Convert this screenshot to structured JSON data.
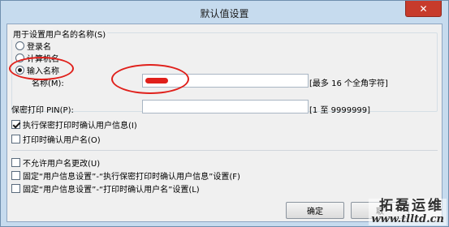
{
  "window": {
    "title": "默认值设置",
    "close_glyph": "✕"
  },
  "username_group": {
    "legend": "用于设置用户名的名称(S)",
    "options": [
      {
        "label": "登录名",
        "checked": false
      },
      {
        "label": "计算机名",
        "checked": false
      },
      {
        "label": "输入名称",
        "checked": true
      }
    ],
    "name_label": "名称(M):",
    "name_value": "",
    "name_hint": "[最多 16 个全角字符]"
  },
  "pin": {
    "label": "保密打印 PIN(P):",
    "value": "",
    "hint": "[1 至 9999999]"
  },
  "checks_top": [
    {
      "label": "执行保密打印时确认用户信息(I)",
      "checked": true
    },
    {
      "label": "打印时确认用户名(O)",
      "checked": false
    }
  ],
  "checks_bottom": [
    {
      "label": "不允许用户名更改(U)",
      "checked": false
    },
    {
      "label": "固定“用户信息设置”-“执行保密打印时确认用户信息”设置(F)",
      "checked": false
    },
    {
      "label": "固定“用户信息设置”-“打印时确认用户名”设置(L)",
      "checked": false
    }
  ],
  "buttons": {
    "ok": "确定",
    "cancel": "取"
  },
  "watermark": {
    "text": "拓磊运维",
    "url": "www.tlltd.cn"
  },
  "colors": {
    "highlight": "#e0201b",
    "titlebar": "#c6dbee",
    "close": "#c73b2b"
  }
}
